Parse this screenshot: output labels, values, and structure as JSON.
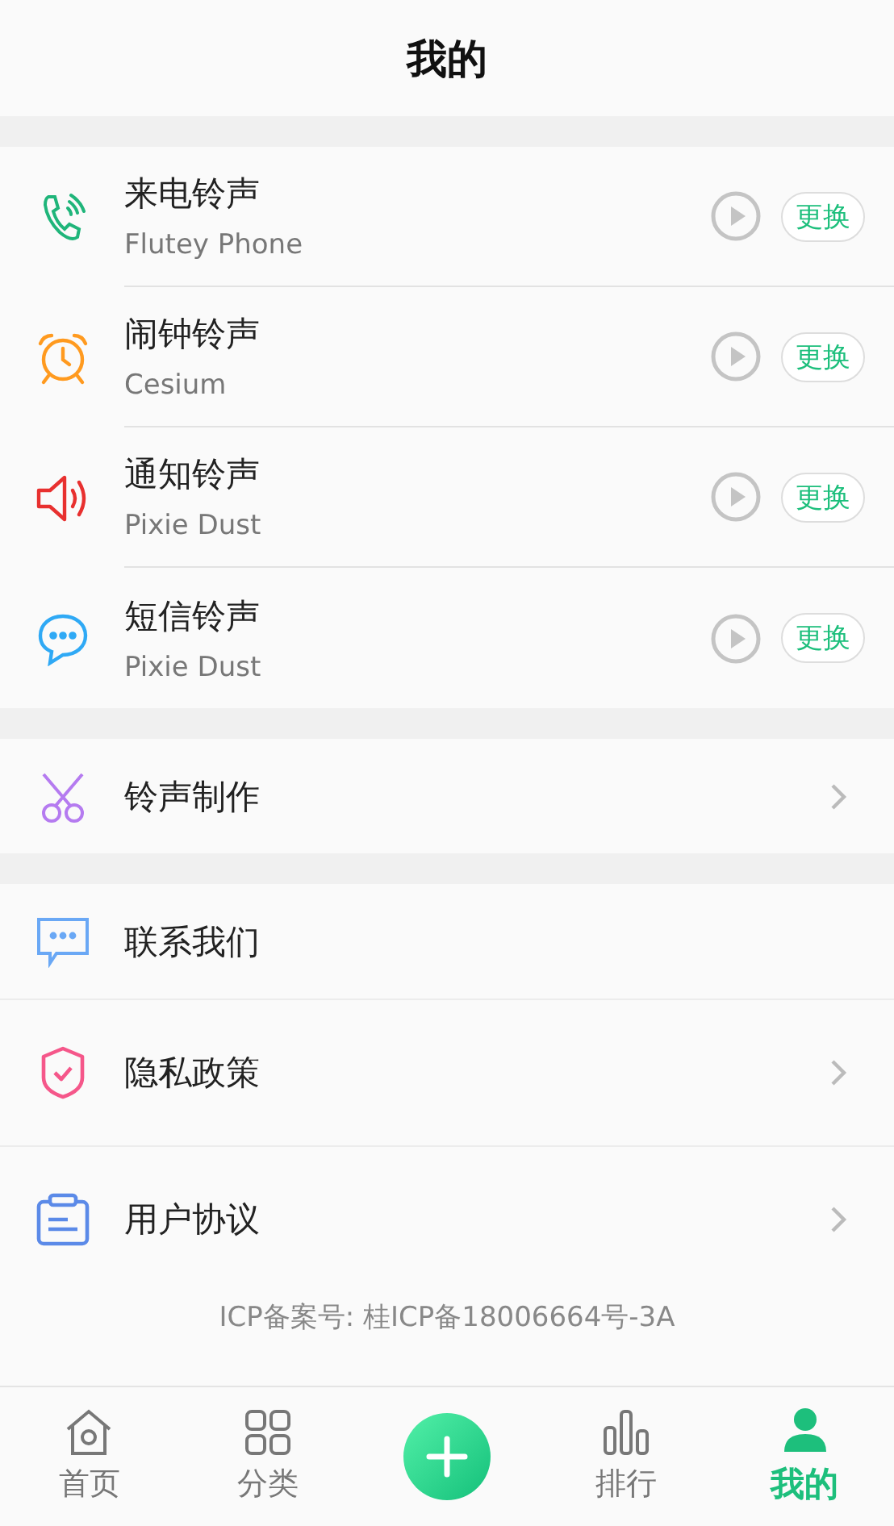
{
  "header": {
    "title": "我的"
  },
  "ringtones": [
    {
      "title": "来电铃声",
      "subtitle": "Flutey Phone",
      "button": "更换"
    },
    {
      "title": "闹钟铃声",
      "subtitle": "Cesium",
      "button": "更换"
    },
    {
      "title": "通知铃声",
      "subtitle": "Pixie Dust",
      "button": "更换"
    },
    {
      "title": "短信铃声",
      "subtitle": "Pixie Dust",
      "button": "更换"
    }
  ],
  "maker": {
    "label": "铃声制作",
    "chevron": true
  },
  "links": [
    {
      "label": "联系我们",
      "chevron": false
    },
    {
      "label": "隐私政策",
      "chevron": true
    },
    {
      "label": "用户协议",
      "chevron": true
    }
  ],
  "footer": "ICP备案号: 桂ICP备18006664号-3A",
  "tabs": [
    {
      "kind": "tab",
      "label": "首页",
      "selected": false
    },
    {
      "kind": "tab",
      "label": "分类",
      "selected": false
    },
    {
      "kind": "add"
    },
    {
      "kind": "tab",
      "label": "排行",
      "selected": false
    },
    {
      "kind": "tab",
      "label": "我的",
      "selected": true
    }
  ]
}
